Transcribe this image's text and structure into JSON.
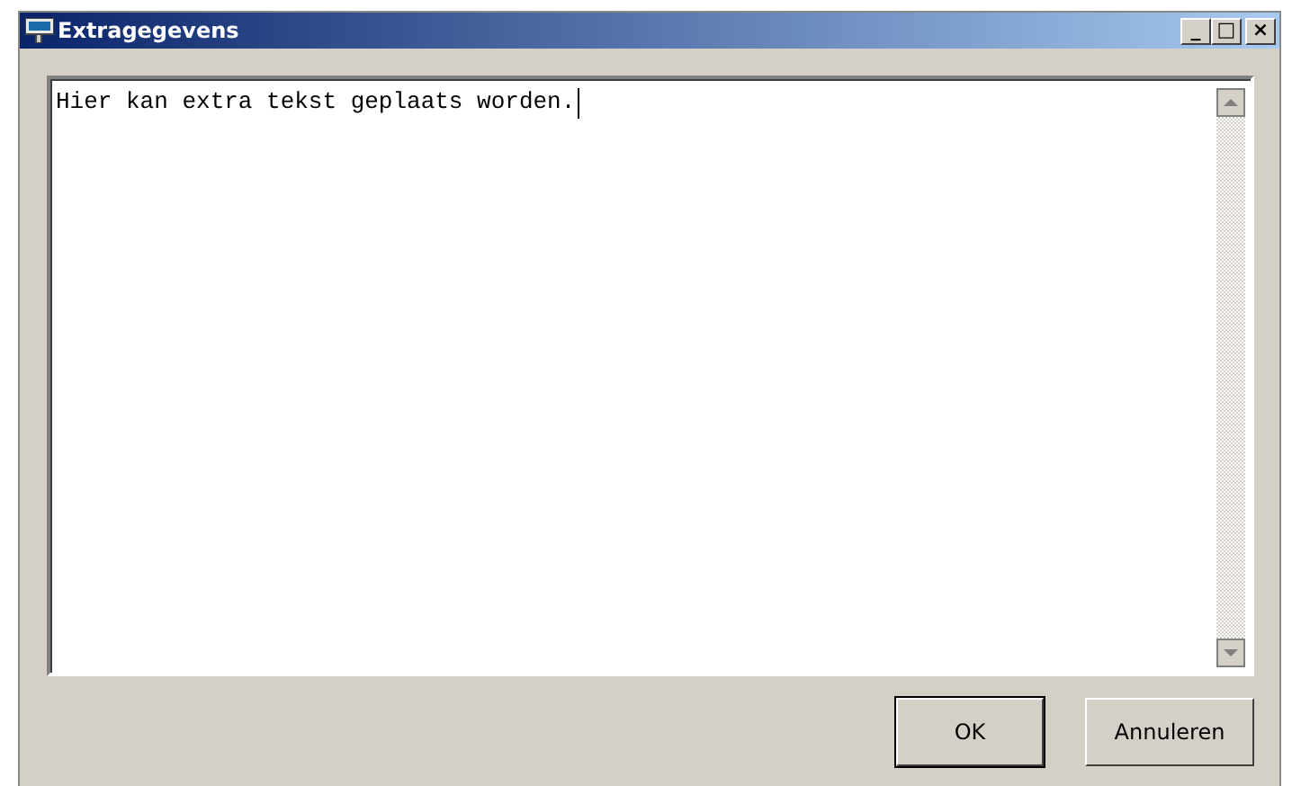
{
  "window": {
    "title": "Extragegevens",
    "controls": [
      "_",
      "□",
      "×"
    ]
  },
  "text_field": {
    "value": "Hier kan extra tekst geplaats worden.",
    "focused": true
  },
  "buttons": [
    {
      "label": "OK",
      "default": true
    },
    {
      "label": "Annuleren",
      "default": false
    }
  ]
}
